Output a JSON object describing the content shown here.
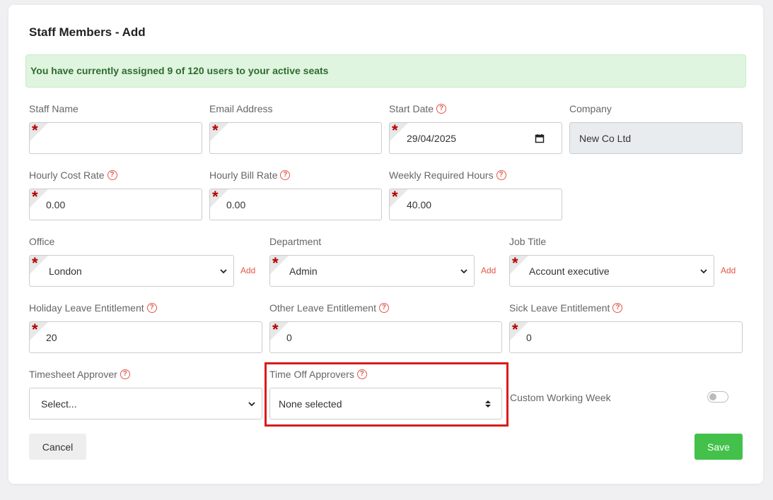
{
  "page": {
    "title": "Staff Members - Add",
    "alert": "You have currently assigned 9 of 120 users to your active seats"
  },
  "fields": {
    "staff_name": {
      "label": "Staff Name",
      "value": ""
    },
    "email": {
      "label": "Email Address",
      "value": ""
    },
    "start_date": {
      "label": "Start Date",
      "value": "29/04/2025"
    },
    "company": {
      "label": "Company",
      "value": "New Co Ltd"
    },
    "hourly_cost": {
      "label": "Hourly Cost Rate",
      "value": "0.00"
    },
    "hourly_bill": {
      "label": "Hourly Bill Rate",
      "value": "0.00"
    },
    "weekly_hours": {
      "label": "Weekly Required Hours",
      "value": "40.00"
    },
    "office": {
      "label": "Office",
      "value": "London"
    },
    "department": {
      "label": "Department",
      "value": "Admin"
    },
    "job_title": {
      "label": "Job Title",
      "value": "Account executive"
    },
    "holiday_leave": {
      "label": "Holiday Leave Entitlement",
      "value": "20"
    },
    "other_leave": {
      "label": "Other Leave Entitlement",
      "value": "0"
    },
    "sick_leave": {
      "label": "Sick Leave Entitlement",
      "value": "0"
    },
    "timesheet_approver": {
      "label": "Timesheet Approver",
      "value": "Select..."
    },
    "time_off_approvers": {
      "label": "Time Off Approvers",
      "value": "None selected"
    },
    "custom_week": {
      "label": "Custom Working Week"
    }
  },
  "common": {
    "add_label": "Add",
    "required_mark": "*",
    "help_mark": "?"
  },
  "buttons": {
    "cancel": "Cancel",
    "save": "Save"
  },
  "colors": {
    "accent_red": "#e2574c",
    "save_green": "#43c14b",
    "alert_bg": "#dff5df",
    "alert_text": "#2e6b2e",
    "highlight": "#d81c1c"
  }
}
